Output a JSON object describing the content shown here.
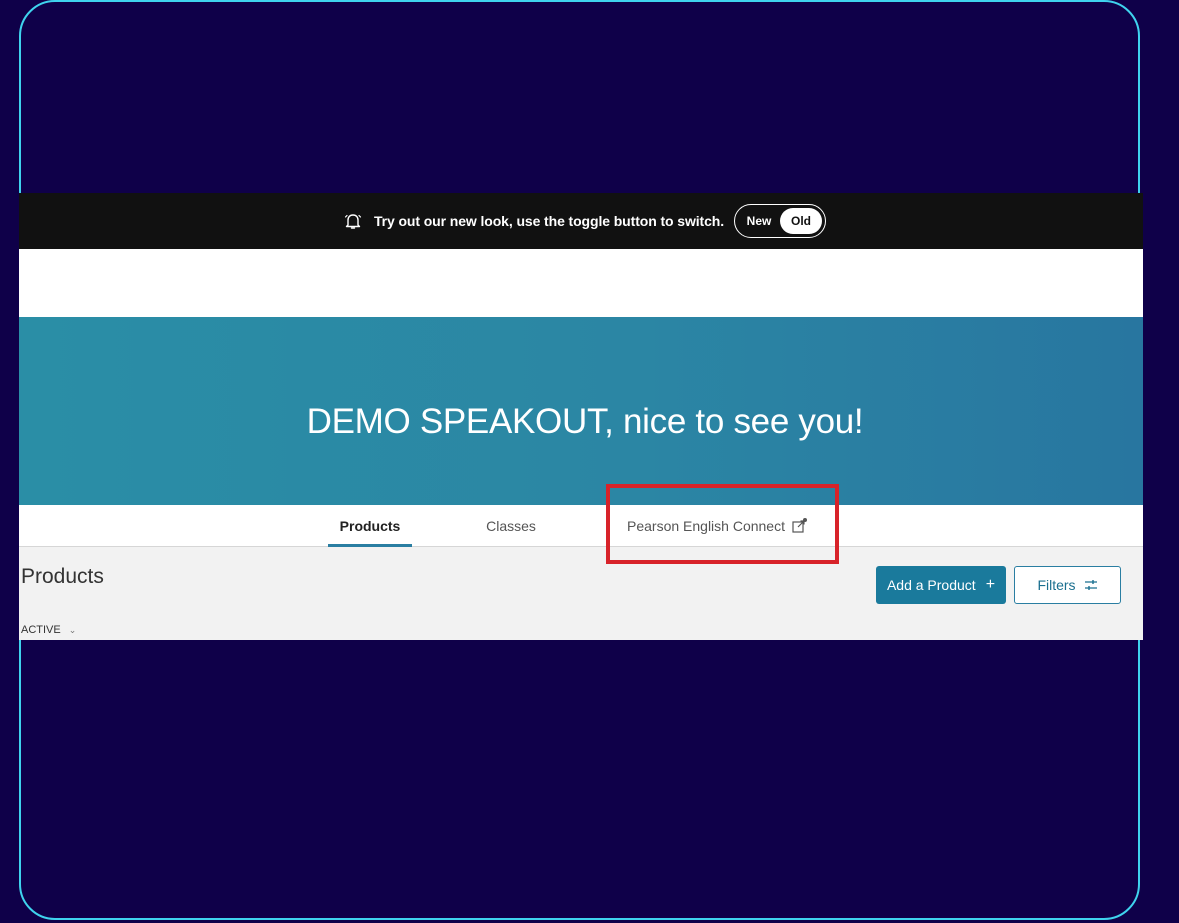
{
  "banner": {
    "message": "Try out our new look, use the toggle button to switch.",
    "toggle_new": "New",
    "toggle_old": "Old"
  },
  "hero": {
    "greeting": "DEMO SPEAKOUT, nice to see you!"
  },
  "tabs": [
    {
      "label": "Products"
    },
    {
      "label": "Classes"
    },
    {
      "label": "Pearson English Connect"
    }
  ],
  "main": {
    "title": "Products",
    "status_filter": "ACTIVE",
    "add_product_label": "Add a Product",
    "filters_label": "Filters"
  },
  "colors": {
    "background": "#0f0049",
    "frame_border": "#3fd3ee",
    "hero": "#2a8ea6",
    "primary_button": "#1a7a9c",
    "highlight": "#d8232a"
  }
}
